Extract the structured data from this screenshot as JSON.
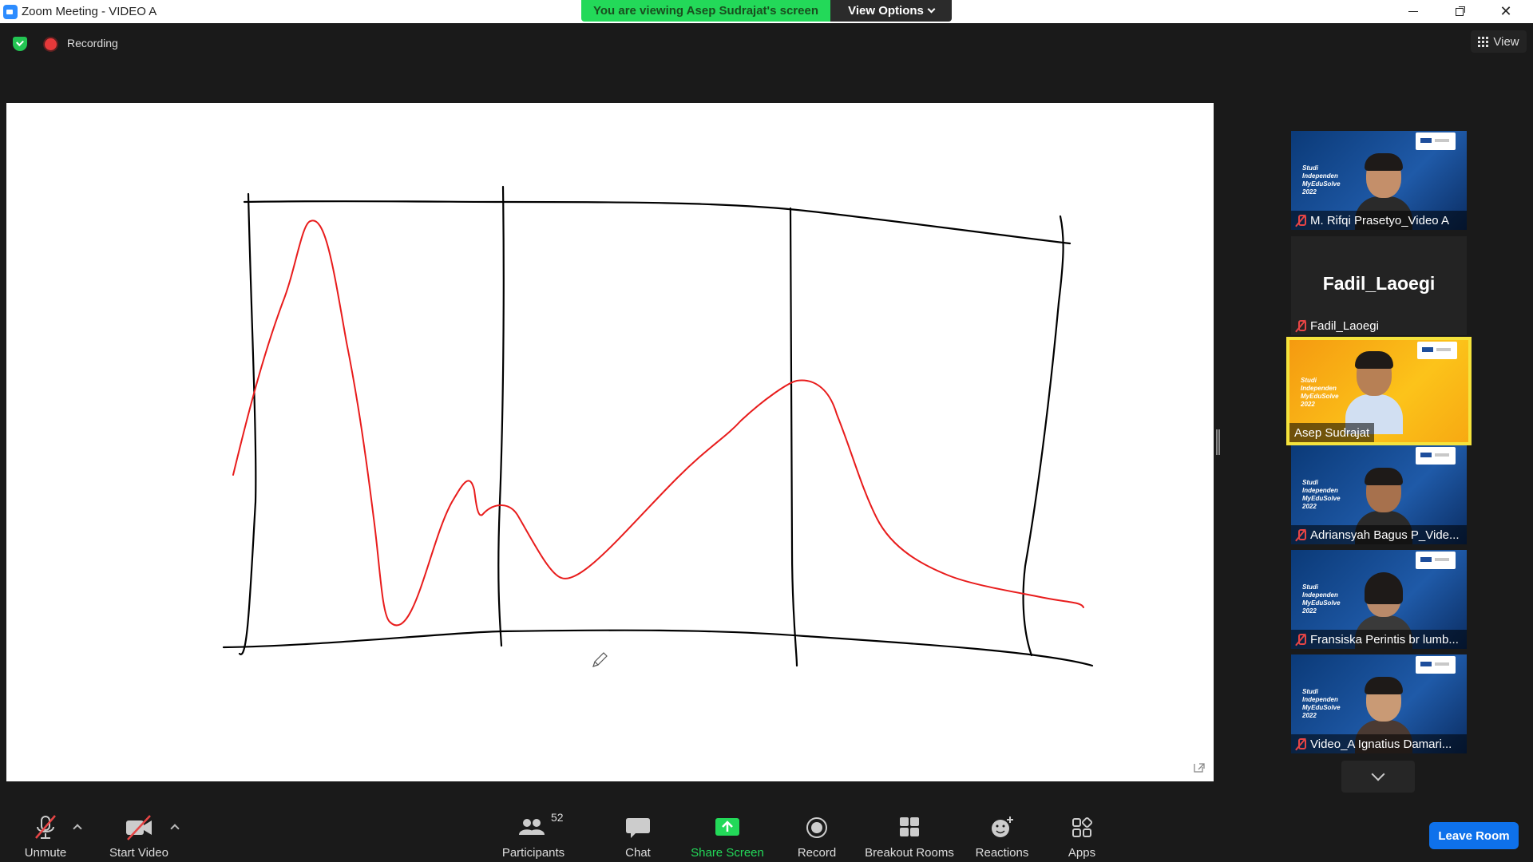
{
  "window": {
    "title": "Zoom Meeting - VIDEO A",
    "viewing_banner": "You are viewing Asep Sudrajat's screen",
    "view_options": "View Options"
  },
  "topbar": {
    "recording": "Recording",
    "view": "View"
  },
  "whiteboard": {
    "stroke_colors": {
      "frame": "#000000",
      "curve": "#e81c1c"
    }
  },
  "participants": [
    {
      "name": "M. Rifqi Prasetyo_Video A",
      "brand": "Studi Independen MyEduSolve 2022",
      "muted": true,
      "active": false,
      "video": true
    },
    {
      "name": "Fadil_Laoegi",
      "display_name": "Fadil_Laoegi",
      "muted": true,
      "active": false,
      "video": false
    },
    {
      "name": "Asep Sudrajat",
      "brand": "Studi Independen MyEduSolve 2022",
      "muted": false,
      "active": true,
      "video": true
    },
    {
      "name": "Adriansyah Bagus P_Vide...",
      "brand": "Studi Independen MyEduSolve 2022",
      "muted": true,
      "active": false,
      "video": true
    },
    {
      "name": "Fransiska Perintis br lumb...",
      "brand": "Studi Independen MyEduSolve 2022",
      "muted": true,
      "active": false,
      "video": true
    },
    {
      "name": "Video_A Ignatius Damari...",
      "brand": "Studi Independen MyEduSolve 2022",
      "muted": true,
      "active": false,
      "video": true
    }
  ],
  "toolbar": {
    "unmute": "Unmute",
    "start_video": "Start Video",
    "participants": "Participants",
    "participants_count": "52",
    "chat": "Chat",
    "share_screen": "Share Screen",
    "record": "Record",
    "breakout_rooms": "Breakout Rooms",
    "reactions": "Reactions",
    "apps": "Apps",
    "leave": "Leave Room"
  },
  "colors": {
    "banner_green": "#23d959",
    "leave_blue": "#0e71eb",
    "active_speaker": "#f5e33c",
    "mute_red": "#e64545"
  }
}
